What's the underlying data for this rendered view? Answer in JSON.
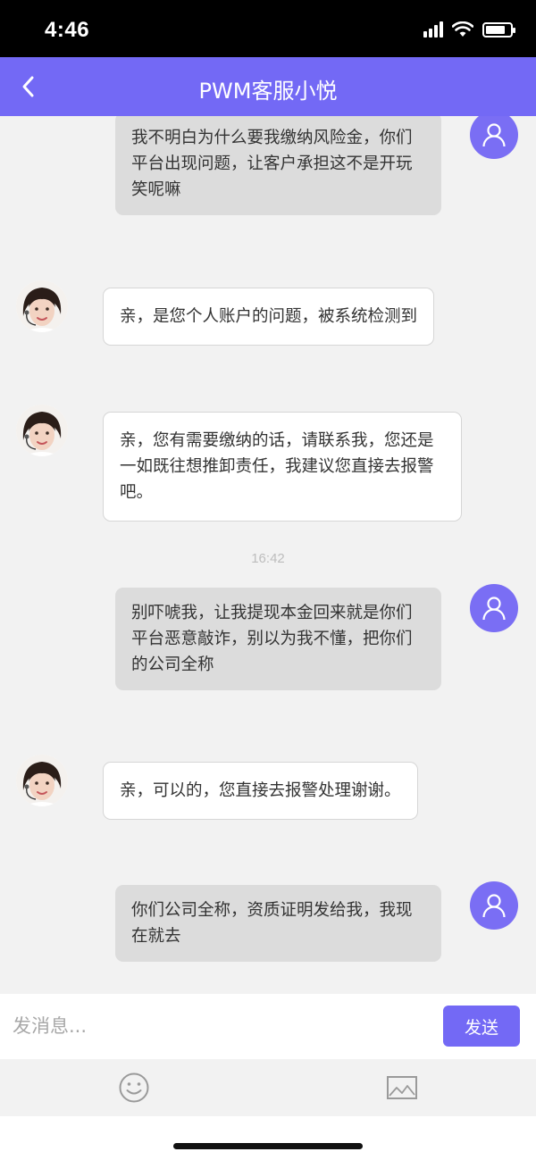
{
  "status_bar": {
    "time": "4:46",
    "battery_level": 0.8
  },
  "header": {
    "title": "PWM客服小悦",
    "back_icon": "chevron-left-icon"
  },
  "chat": {
    "messages": [
      {
        "sender": "user",
        "text": "我不明白为什么要我缴纳风险金，你们平台出现问题，让客户承担这不是开玩笑呢嘛"
      },
      {
        "sender": "agent",
        "text": "亲，是您个人账户的问题，被系统检测到"
      },
      {
        "sender": "agent",
        "text": "亲，您有需要缴纳的话，请联系我，您还是一如既往想推卸责任，我建议您直接去报警吧。"
      },
      {
        "sender": "user",
        "text": "别吓唬我，让我提现本金回来就是你们平台恶意敲诈，别以为我不懂，把你们的公司全称"
      },
      {
        "sender": "agent",
        "text": "亲，可以的，您直接去报警处理谢谢。"
      },
      {
        "sender": "user",
        "text": "你们公司全称，资质证明发给我，我现在就去"
      }
    ],
    "timestamp": "16:42"
  },
  "input_bar": {
    "placeholder": "发消息...",
    "send_label": "发送"
  },
  "toolbar": {
    "emoji_icon": "smiley-icon",
    "image_icon": "image-icon"
  },
  "colors": {
    "accent": "#7369f5",
    "user_bubble": "#dcdcdc",
    "agent_bubble": "#ffffff",
    "background": "#f2f2f2"
  }
}
